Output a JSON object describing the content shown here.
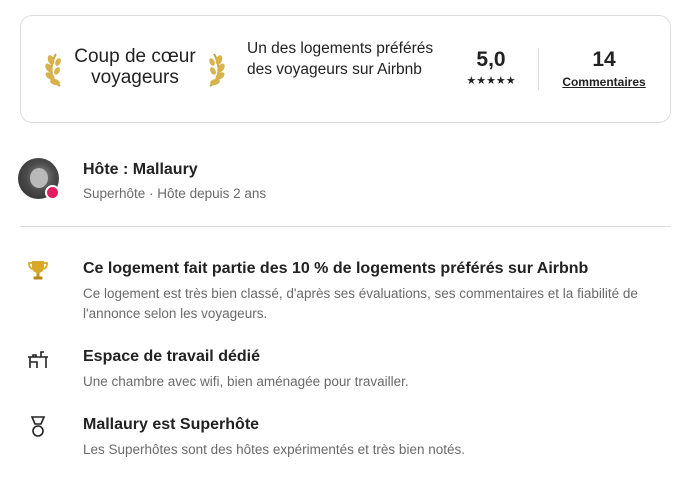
{
  "guest_favorite": {
    "title": "Coup de cœur voyageurs",
    "description": "Un des logements préférés des voyageurs sur Airbnb",
    "rating": "5,0",
    "stars": "★★★★★",
    "reviews_count": "14",
    "reviews_label": "Commentaires",
    "laurel_color": "#D8B24A"
  },
  "host": {
    "name": "Hôte : Mallaury",
    "subtitle": "Superhôte · Hôte depuis 2 ans",
    "badge_color": "#E31C5F"
  },
  "highlights": [
    {
      "icon": "trophy-icon",
      "title": "Ce logement fait partie des 10 % de logements préférés sur Airbnb",
      "description": "Ce logement est très bien classé, d'après ses évaluations, ses commentaires et la fiabilité de l'annonce selon les voyageurs."
    },
    {
      "icon": "desk-icon",
      "title": "Espace de travail dédié",
      "description": "Une chambre avec wifi, bien aménagée pour travailler."
    },
    {
      "icon": "superhost-medal-icon",
      "title": "Mallaury est Superhôte",
      "description": "Les Superhôtes sont des hôtes expérimentés et très bien notés."
    }
  ]
}
